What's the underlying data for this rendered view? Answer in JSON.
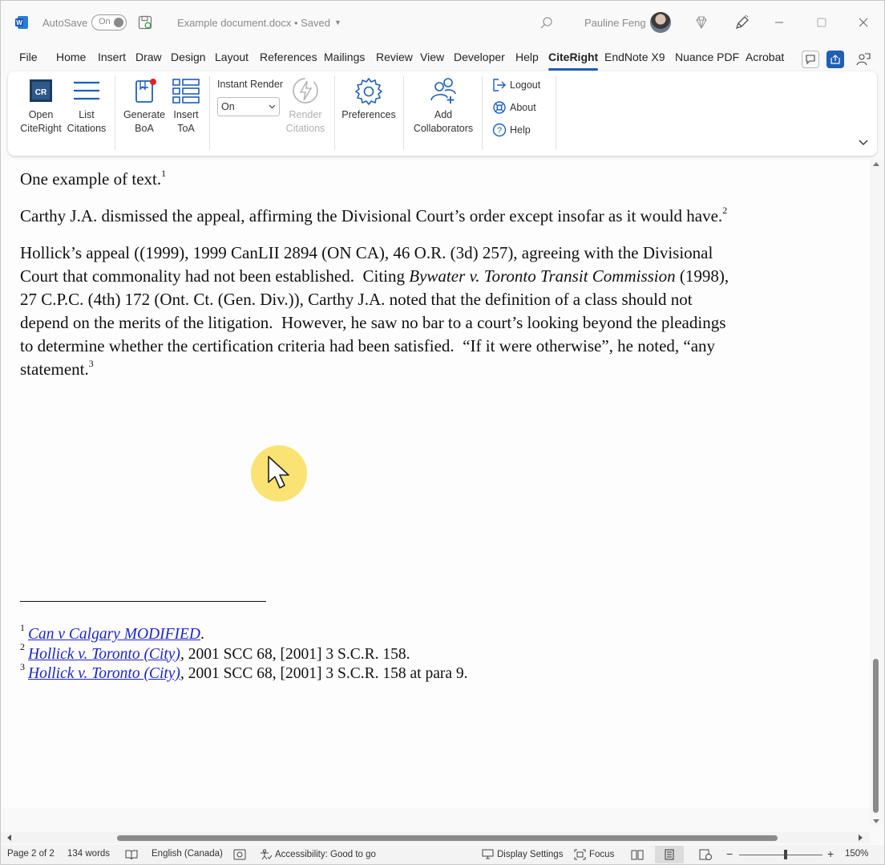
{
  "titlebar": {
    "app_icon": "word-logo-icon",
    "autosave_label": "AutoSave",
    "autosave_toggle": "On",
    "document_title": "Example document.docx • Saved",
    "user_name": "Pauline Feng"
  },
  "tabs": [
    "File",
    "Home",
    "Insert",
    "Draw",
    "Design",
    "Layout",
    "References",
    "Mailings",
    "Review",
    "View",
    "Developer",
    "Help",
    "CiteRight",
    "EndNote X9",
    "Nuance PDF",
    "Acrobat"
  ],
  "active_tab": "CiteRight",
  "ribbon": {
    "open_citeright": [
      "Open",
      "CiteRight"
    ],
    "list_citations": [
      "List",
      "Citations"
    ],
    "generate_boa": [
      "Generate",
      "BoA"
    ],
    "insert_toa": [
      "Insert",
      "ToA"
    ],
    "instant_render_label": "Instant Render",
    "instant_render_value": "On",
    "render_citations": [
      "Render",
      "Citations"
    ],
    "preferences": "Preferences",
    "add_collaborators": [
      "Add",
      "Collaborators"
    ],
    "logout": "Logout",
    "about": "About",
    "help": "Help"
  },
  "document": {
    "p1_text": "One example of text.",
    "p1_ref": "1",
    "p2_text": "Carthy J.A. dismissed the appeal, affirming the Divisional Court’s order except insofar as it would have.",
    "p2_ref": "2",
    "p3_lines": [
      "Hollick’s appeal ((1999), 1999 CanLII 2894 (ON CA), 46 O.R. (3d) 257), agreeing with the Divisional",
      "Court that commonality had not been established.  Citing ",
      "Bywater v. Toronto Transit Commission",
      " (1998),",
      "27 C.P.C. (4th) 172 (Ont. Ct. (Gen. Div.)), Carthy J.A. noted that the definition of a class should not",
      "depend on the merits of the litigation.  However, he saw no bar to a court’s looking beyond the pleadings",
      "to determine whether the certification criteria had been satisfied.  “If it were otherwise”, he noted, “any",
      "statement."
    ],
    "p3_ref": "3",
    "footnotes": [
      {
        "num": "1",
        "link": "Can v Calgary MODIFIED",
        "rest": "."
      },
      {
        "num": "2",
        "link": "Hollick v. Toronto (City)",
        "rest": ", 2001 SCC 68, [2001] 3 S.C.R. 158."
      },
      {
        "num": "3",
        "link": "Hollick v. Toronto (City)",
        "rest": ", 2001 SCC 68, [2001] 3 S.C.R. 158 at para 9."
      }
    ]
  },
  "status": {
    "page": "Page 2 of 2",
    "words": "134 words",
    "language": "English (Canada)",
    "accessibility": "Accessibility: Good to go",
    "display_settings": "Display Settings",
    "focus": "Focus",
    "zoom": "150%"
  },
  "colors": {
    "accent": "#1f5fb4",
    "link": "#1d25c8",
    "cursor_highlight": "#f9de59"
  }
}
